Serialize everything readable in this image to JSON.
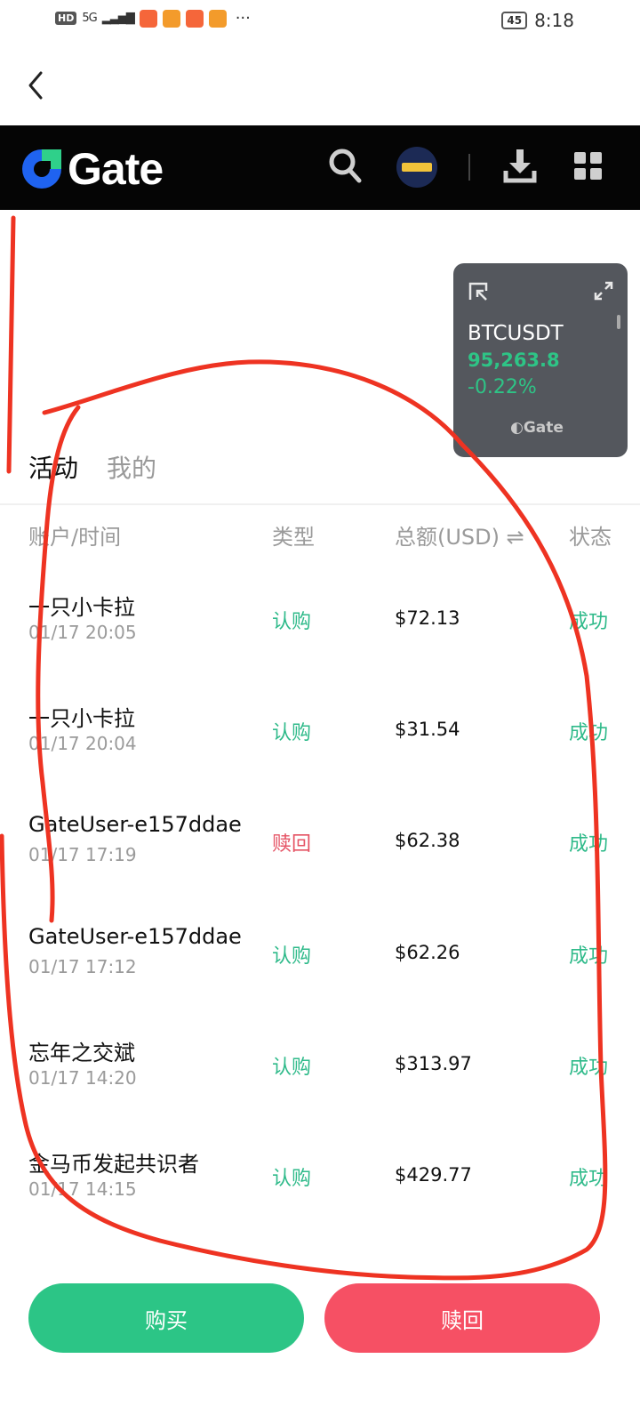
{
  "status_bar": {
    "network": "HD",
    "signal": "5G",
    "battery": "45",
    "time": "8:18",
    "more": "···"
  },
  "nav": {
    "back_icon": "chevron-left-icon"
  },
  "header": {
    "logo_text": "Gate",
    "icons": [
      "search-icon",
      "avatar",
      "download-icon",
      "grid-icon"
    ]
  },
  "ticker": {
    "symbol": "BTCUSDT",
    "price": "95,263.8",
    "change": "-0.22%",
    "brand": "Gate",
    "up_color": "#2ec486"
  },
  "tabs": [
    {
      "label": "活动",
      "active": true
    },
    {
      "label": "我的",
      "active": false
    }
  ],
  "table": {
    "headers": {
      "account_time": "账户/时间",
      "type": "类型",
      "total": "总额(USD) ⇌",
      "status": "状态"
    },
    "rows": [
      {
        "account": "一只小卡拉",
        "time": "01/17 20:05",
        "type": "认购",
        "type_kind": "buy",
        "amount": "$72.13",
        "status": "成功"
      },
      {
        "account": "一只小卡拉",
        "time": "01/17 20:04",
        "type": "认购",
        "type_kind": "buy",
        "amount": "$31.54",
        "status": "成功"
      },
      {
        "account": "GateUser-e157ddae",
        "time": "01/17 17:19",
        "type": "赎回",
        "type_kind": "sell",
        "amount": "$62.38",
        "status": "成功"
      },
      {
        "account": "GateUser-e157ddae",
        "time": "01/17 17:12",
        "type": "认购",
        "type_kind": "buy",
        "amount": "$62.26",
        "status": "成功"
      },
      {
        "account": "忘年之交斌",
        "time": "01/17 14:20",
        "type": "认购",
        "type_kind": "buy",
        "amount": "$313.97",
        "status": "成功"
      },
      {
        "account": "金马币发起共识者",
        "time": "01/17 14:15",
        "type": "认购",
        "type_kind": "buy",
        "amount": "$429.77",
        "status": "成功"
      }
    ]
  },
  "actions": {
    "buy_label": "购买",
    "redeem_label": "赎回",
    "buy_color": "#2cc586",
    "redeem_color": "#f65064"
  }
}
